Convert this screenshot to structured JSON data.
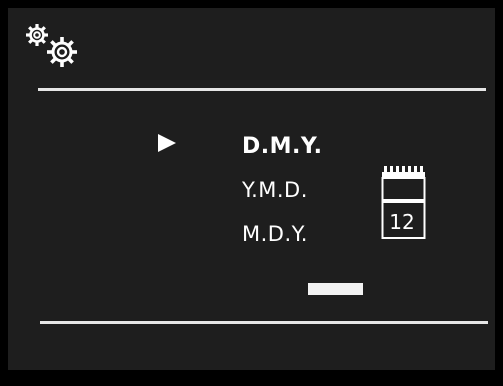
{
  "screen": {
    "icon": "settings-gears-icon",
    "accent": "#ffffff",
    "background": "#1e1e1e"
  },
  "date_format_menu": {
    "options": [
      "D.M.Y.",
      "Y.M.D.",
      "M.D.Y."
    ],
    "selected_index": 0
  },
  "calendar": {
    "icon": "calendar-icon",
    "day": "12"
  },
  "confirm": {
    "icon": "confirm-bar"
  }
}
